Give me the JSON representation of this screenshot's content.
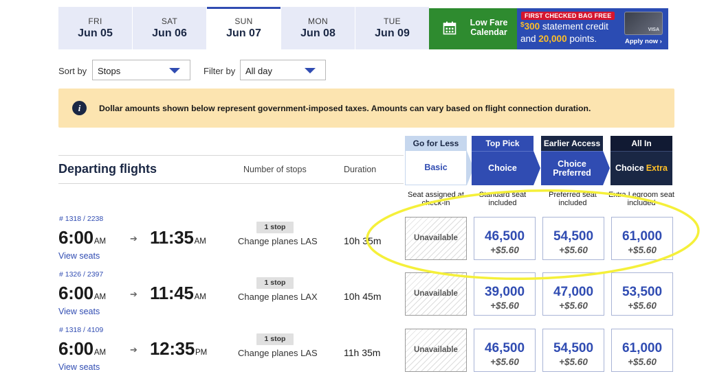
{
  "dates": [
    {
      "dow": "FRI",
      "date": "Jun 05"
    },
    {
      "dow": "SAT",
      "date": "Jun 06"
    },
    {
      "dow": "SUN",
      "date": "Jun 07"
    },
    {
      "dow": "MON",
      "date": "Jun 08"
    },
    {
      "dow": "TUE",
      "date": "Jun 09"
    }
  ],
  "low_fare": {
    "line1": "Low Fare",
    "line2": "Calendar",
    "icon": "calendar-icon"
  },
  "promo": {
    "badge": "FIRST CHECKED BAG FREE",
    "dollar": "$",
    "amount": "300",
    "line1_rest": " statement credit",
    "line2_prefix": "and ",
    "points": "20,000",
    "line2_suffix": " points.",
    "apply": "Apply now ›",
    "card_logo": "VISA"
  },
  "controls": {
    "sort_label": "Sort by",
    "sort_value": "Stops",
    "filter_label": "Filter by",
    "filter_value": "All day"
  },
  "banner": {
    "text": "Dollar amounts shown below represent government-imposed taxes. Amounts can vary based on flight connection duration.",
    "icon": "info-icon"
  },
  "section": {
    "title": "Departing flights",
    "col_stops": "Number of stops",
    "col_duration": "Duration"
  },
  "fare_types": [
    {
      "top": "Go for Less",
      "name": "Basic",
      "desc": "Seat assigned at check-in"
    },
    {
      "top": "Top Pick",
      "name": "Choice",
      "desc": "Standard seat included"
    },
    {
      "top": "Earlier Access",
      "name": "Choice Preferred",
      "desc": "Preferred seat included"
    },
    {
      "top": "All In",
      "name": "Choice",
      "name_extra": "Extra",
      "desc": "Extra Legroom seat included"
    }
  ],
  "flights": [
    {
      "number": "# 1318 / 2238",
      "depart": "6:00",
      "depart_ampm": "AM",
      "arrive": "11:35",
      "arrive_ampm": "AM",
      "view_seats": "View seats",
      "stops": "1 stop",
      "change": "Change planes LAS",
      "duration": "10h 35m",
      "fares": [
        {
          "unavailable": "Unavailable"
        },
        {
          "points": "46,500",
          "tax": "+$5.60"
        },
        {
          "points": "54,500",
          "tax": "+$5.60"
        },
        {
          "points": "61,000",
          "tax": "+$5.60"
        }
      ]
    },
    {
      "number": "# 1326 / 2397",
      "depart": "6:00",
      "depart_ampm": "AM",
      "arrive": "11:45",
      "arrive_ampm": "AM",
      "view_seats": "View seats",
      "stops": "1 stop",
      "change": "Change planes LAX",
      "duration": "10h 45m",
      "fares": [
        {
          "unavailable": "Unavailable"
        },
        {
          "points": "39,000",
          "tax": "+$5.60"
        },
        {
          "points": "47,000",
          "tax": "+$5.60"
        },
        {
          "points": "53,500",
          "tax": "+$5.60"
        }
      ]
    },
    {
      "number": "# 1318 / 4109",
      "depart": "6:00",
      "depart_ampm": "AM",
      "arrive": "12:35",
      "arrive_ampm": "PM",
      "view_seats": "View seats",
      "stops": "1 stop",
      "change": "Change planes LAS",
      "duration": "11h 35m",
      "fares": [
        {
          "unavailable": "Unavailable"
        },
        {
          "points": "46,500",
          "tax": "+$5.60"
        },
        {
          "points": "54,500",
          "tax": "+$5.60"
        },
        {
          "points": "61,000",
          "tax": "+$5.60"
        }
      ]
    }
  ],
  "colors": {
    "brand_blue": "#304cb2",
    "navy": "#1a2744",
    "green": "#2e8b2f",
    "banner": "#fce4b0",
    "highlight": "#f5f03a"
  }
}
